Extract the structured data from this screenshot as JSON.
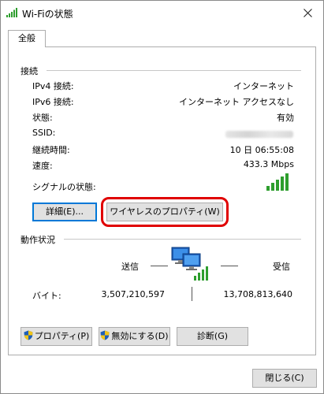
{
  "window": {
    "title": "Wi-Fiの状態"
  },
  "tabs": [
    {
      "label": "全般"
    }
  ],
  "connection": {
    "group_label": "接続",
    "rows": [
      {
        "label": "IPv4 接続:",
        "value": "インターネット"
      },
      {
        "label": "IPv6 接続:",
        "value": "インターネット アクセスなし"
      },
      {
        "label": "状態:",
        "value": "有効"
      },
      {
        "label": "SSID:",
        "value": ""
      },
      {
        "label": "継続時間:",
        "value": "10 日 06:55:08"
      },
      {
        "label": "速度:",
        "value": "433.3 Mbps"
      }
    ],
    "signal_label": "シグナルの状態:",
    "signal_bars": 5
  },
  "buttons": {
    "details": "詳細(E)...",
    "wireless_props": "ワイヤレスのプロパティ(W)",
    "properties": "プロパティ(P)",
    "disable": "無効にする(D)",
    "diagnose": "診断(G)",
    "close": "閉じる(C)"
  },
  "activity": {
    "group_label": "動作状況",
    "sent_label": "送信",
    "received_label": "受信",
    "bytes_label": "バイト:",
    "bytes_sent": "3,507,210,597",
    "bytes_received": "13,708,813,640"
  },
  "icons": {
    "title": "wifi-signal-icon",
    "close": "close-icon",
    "network": "network-computers-icon",
    "shield": "uac-shield-icon"
  },
  "colors": {
    "signal_green": "#2e9e2e",
    "highlight_red": "#e00000",
    "focus_blue": "#0078d7"
  }
}
